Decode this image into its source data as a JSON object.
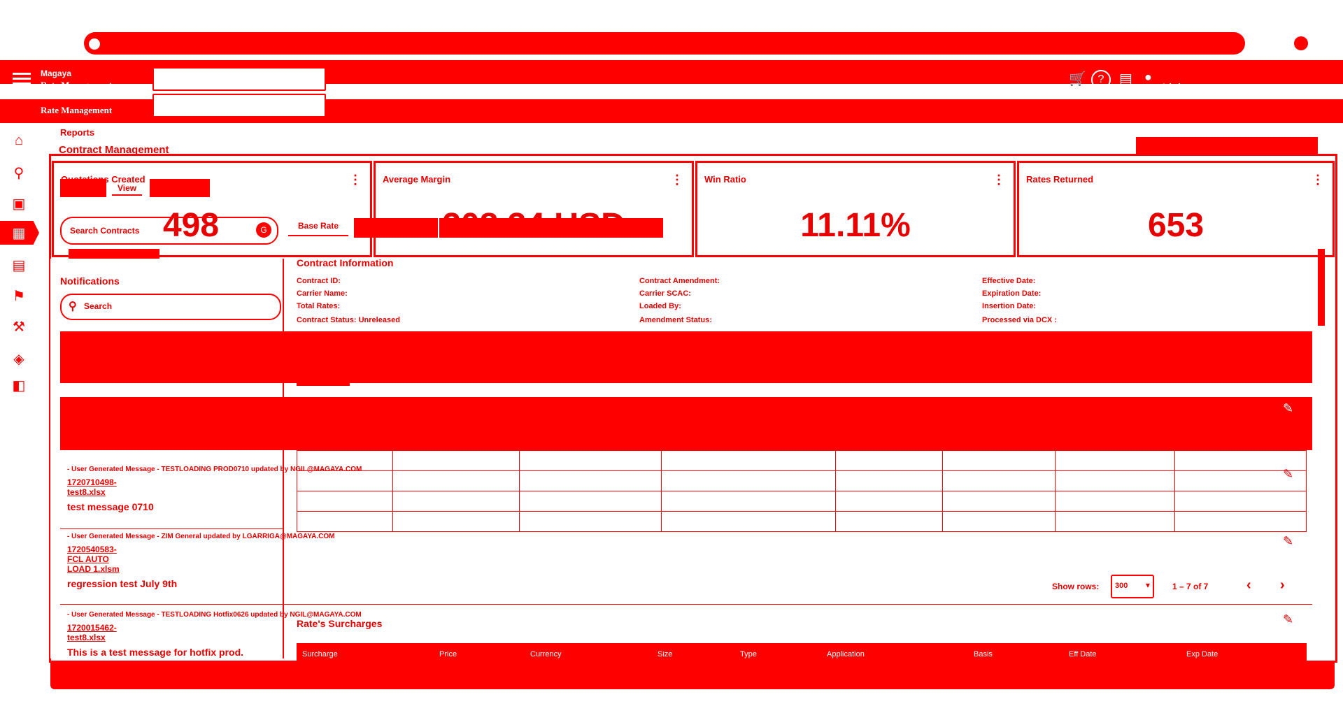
{
  "browser": {
    "address_placeholder": ""
  },
  "header": {
    "app_name": "Magaya",
    "module": "Rate Management",
    "user_label": "Admin"
  },
  "breadcrumb": {
    "parent": "Reports",
    "current": "Contract Management"
  },
  "tabs": {
    "view_label": "View"
  },
  "kpis": [
    {
      "title": "Quotations Created",
      "value": "498"
    },
    {
      "title": "Average Margin",
      "value": "208.34 USD"
    },
    {
      "title": "Win Ratio",
      "value": "11.11%"
    },
    {
      "title": "Rates Returned",
      "value": "653"
    }
  ],
  "left_panel": {
    "search_contracts_label": "Search Contracts",
    "filter_badge": "G",
    "notifications_title": "Notifications",
    "search_placeholder": "Search"
  },
  "base_rate_tab": "Base Rate",
  "contract_info": {
    "title": "Contract Information",
    "fields": {
      "contract_id": "Contract ID:",
      "carrier_name": "Carrier Name:",
      "total_rates": "Total Rates:",
      "contract_status": "Contract Status: Unreleased",
      "contract_amendment": "Contract Amendment:",
      "carrier_scac": "Carrier SCAC:",
      "loaded_by": "Loaded By:",
      "amendment_status": "Amendment Status:",
      "effective_date": "Effective Date:",
      "expiration_date": "Expiration Date:",
      "insertion_date": "Insertion Date:",
      "processed_via": "Processed via DCX :"
    }
  },
  "notifications": [
    {
      "header": "- User Generated Message - TESTLOADING PROD0710 updated by NGIL@MAGAYA.COM",
      "file_line1": "1720710498-",
      "file_line2": "test8.xlsx",
      "file_line3": "",
      "message": "test message 0710"
    },
    {
      "header": "- User Generated Message - ZIM General updated by LGARRIGA@MAGAYA.COM",
      "file_line1": "1720540583-",
      "file_line2": "FCL AUTO",
      "file_line3": "LOAD 1.xlsm",
      "message": "regression test July 9th"
    },
    {
      "header": "- User Generated Message - TESTLOADING Hotfix0626 updated by NGIL@MAGAYA.COM",
      "file_line1": "1720015462-",
      "file_line2": "test8.xlsx",
      "file_line3": "",
      "message": "This is a test message for hotfix prod."
    }
  ],
  "pagination": {
    "show_rows_label": "Show rows:",
    "rows_value": "300",
    "range": "1 – 7 of 7"
  },
  "surcharges": {
    "title": "Rate's Surcharges",
    "columns": [
      "Surcharge",
      "Price",
      "Currency",
      "Size",
      "Type",
      "Application",
      "Basis",
      "Eff Date",
      "Exp Date"
    ]
  }
}
